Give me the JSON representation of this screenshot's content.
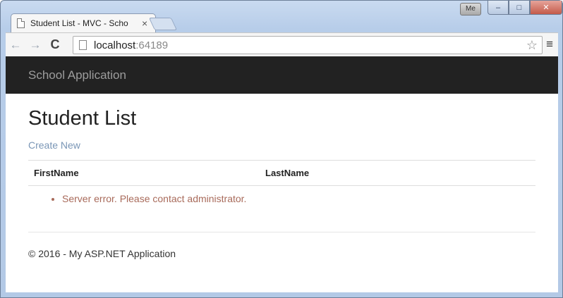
{
  "browser": {
    "tab_title": "Student List - MVC - Scho",
    "tab_close": "×",
    "profile_label": "Me",
    "window_controls": {
      "minimize": "–",
      "restore": "□",
      "close": "✕"
    },
    "nav": {
      "back": "←",
      "forward": "→",
      "reload": "C"
    },
    "address": {
      "host": "localhost",
      "port": ":64189"
    },
    "star": "☆",
    "menu": "≡"
  },
  "app": {
    "brand": "School Application",
    "page_title": "Student List",
    "create_link": "Create New",
    "table": {
      "columns": [
        "FirstName",
        "LastName"
      ]
    },
    "errors": [
      "Server error. Please contact administrator."
    ],
    "footer": "© 2016 - My ASP.NET Application"
  },
  "colors": {
    "navbar_bg": "#222222",
    "brand_text": "#9d9d9d",
    "link": "#7a96b6",
    "error": "#a86a5a"
  }
}
